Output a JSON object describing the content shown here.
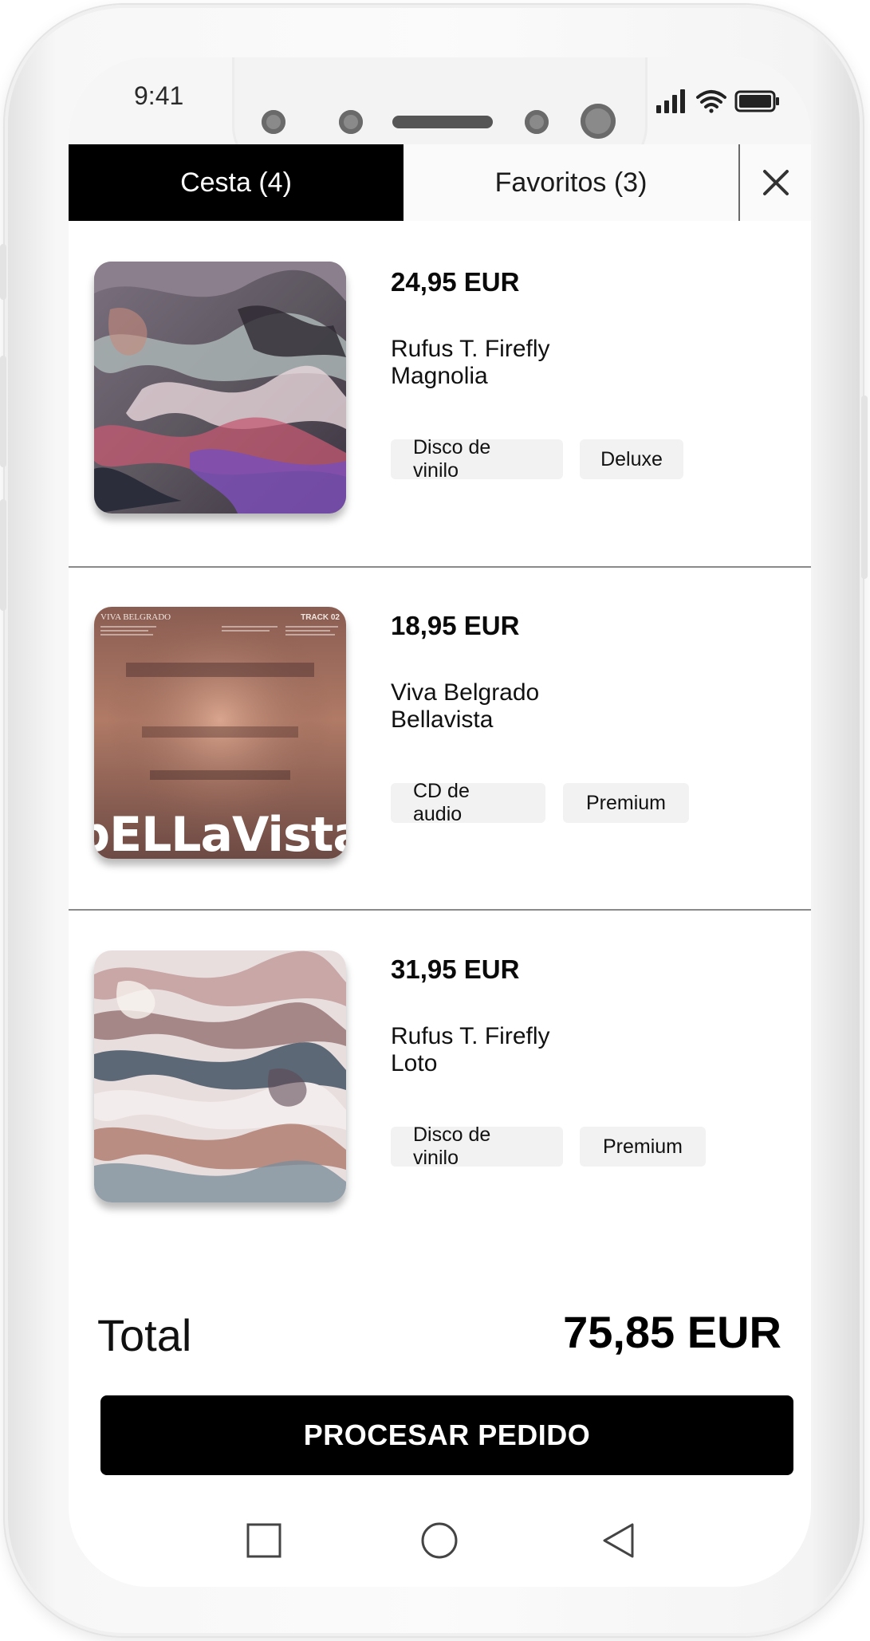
{
  "status_bar": {
    "time": "9:41",
    "icons": [
      "signal-icon",
      "wifi-icon",
      "battery-icon"
    ]
  },
  "tabs": [
    {
      "label": "Cesta (4)",
      "active": true
    },
    {
      "label": "Favoritos (3)",
      "active": false
    }
  ],
  "close_icon": "close-icon",
  "items": [
    {
      "price": "24,95 EUR",
      "artist": "Rufus T. Firefly",
      "album": "Magnolia",
      "tags": [
        "Disco de vinilo",
        "Deluxe"
      ]
    },
    {
      "price": "18,95 EUR",
      "artist": "Viva Belgrado",
      "album": "Bellavista",
      "tags": [
        "CD de audio",
        "Premium"
      ],
      "cover_text": {
        "brand": "VIVA BELGRADO",
        "track": "TRACK 02",
        "title": "bELLaVista"
      }
    },
    {
      "price": "31,95 EUR",
      "artist": "Rufus T. Firefly",
      "album": "Loto",
      "tags": [
        "Disco de vinilo",
        "Premium"
      ]
    }
  ],
  "summary": {
    "total_label": "Total",
    "total_value": "75,85 EUR",
    "process_label": "PROCESAR PEDIDO"
  },
  "nav_bar": [
    "square-icon",
    "circle-icon",
    "back-triangle-icon"
  ],
  "colors": {
    "active_tab": "#000000",
    "button": "#000000",
    "tag_bg": "#f2f2f2"
  }
}
